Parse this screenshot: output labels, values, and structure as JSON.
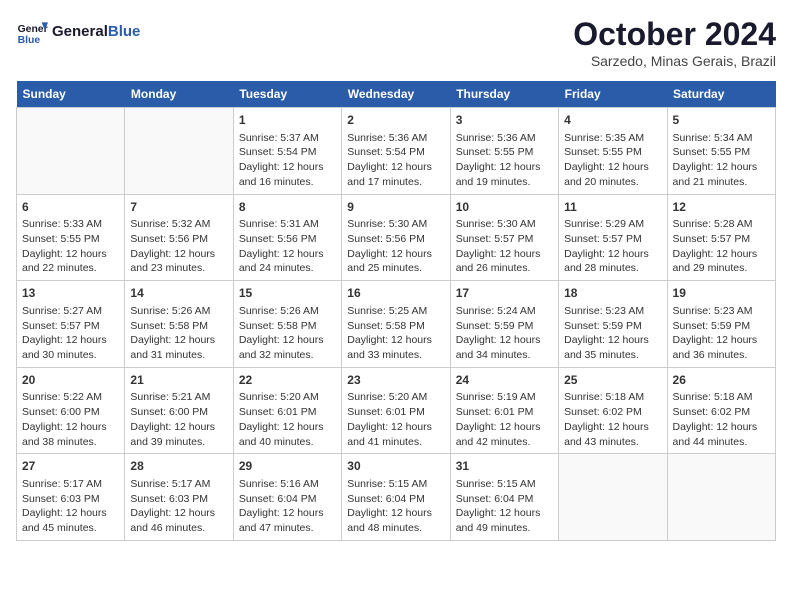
{
  "header": {
    "logo_line1": "General",
    "logo_line2": "Blue",
    "month_title": "October 2024",
    "subtitle": "Sarzedo, Minas Gerais, Brazil"
  },
  "days_of_week": [
    "Sunday",
    "Monday",
    "Tuesday",
    "Wednesday",
    "Thursday",
    "Friday",
    "Saturday"
  ],
  "weeks": [
    [
      {
        "day": "",
        "sunrise": "",
        "sunset": "",
        "daylight": ""
      },
      {
        "day": "",
        "sunrise": "",
        "sunset": "",
        "daylight": ""
      },
      {
        "day": "1",
        "sunrise": "Sunrise: 5:37 AM",
        "sunset": "Sunset: 5:54 PM",
        "daylight": "Daylight: 12 hours and 16 minutes."
      },
      {
        "day": "2",
        "sunrise": "Sunrise: 5:36 AM",
        "sunset": "Sunset: 5:54 PM",
        "daylight": "Daylight: 12 hours and 17 minutes."
      },
      {
        "day": "3",
        "sunrise": "Sunrise: 5:36 AM",
        "sunset": "Sunset: 5:55 PM",
        "daylight": "Daylight: 12 hours and 19 minutes."
      },
      {
        "day": "4",
        "sunrise": "Sunrise: 5:35 AM",
        "sunset": "Sunset: 5:55 PM",
        "daylight": "Daylight: 12 hours and 20 minutes."
      },
      {
        "day": "5",
        "sunrise": "Sunrise: 5:34 AM",
        "sunset": "Sunset: 5:55 PM",
        "daylight": "Daylight: 12 hours and 21 minutes."
      }
    ],
    [
      {
        "day": "6",
        "sunrise": "Sunrise: 5:33 AM",
        "sunset": "Sunset: 5:55 PM",
        "daylight": "Daylight: 12 hours and 22 minutes."
      },
      {
        "day": "7",
        "sunrise": "Sunrise: 5:32 AM",
        "sunset": "Sunset: 5:56 PM",
        "daylight": "Daylight: 12 hours and 23 minutes."
      },
      {
        "day": "8",
        "sunrise": "Sunrise: 5:31 AM",
        "sunset": "Sunset: 5:56 PM",
        "daylight": "Daylight: 12 hours and 24 minutes."
      },
      {
        "day": "9",
        "sunrise": "Sunrise: 5:30 AM",
        "sunset": "Sunset: 5:56 PM",
        "daylight": "Daylight: 12 hours and 25 minutes."
      },
      {
        "day": "10",
        "sunrise": "Sunrise: 5:30 AM",
        "sunset": "Sunset: 5:57 PM",
        "daylight": "Daylight: 12 hours and 26 minutes."
      },
      {
        "day": "11",
        "sunrise": "Sunrise: 5:29 AM",
        "sunset": "Sunset: 5:57 PM",
        "daylight": "Daylight: 12 hours and 28 minutes."
      },
      {
        "day": "12",
        "sunrise": "Sunrise: 5:28 AM",
        "sunset": "Sunset: 5:57 PM",
        "daylight": "Daylight: 12 hours and 29 minutes."
      }
    ],
    [
      {
        "day": "13",
        "sunrise": "Sunrise: 5:27 AM",
        "sunset": "Sunset: 5:57 PM",
        "daylight": "Daylight: 12 hours and 30 minutes."
      },
      {
        "day": "14",
        "sunrise": "Sunrise: 5:26 AM",
        "sunset": "Sunset: 5:58 PM",
        "daylight": "Daylight: 12 hours and 31 minutes."
      },
      {
        "day": "15",
        "sunrise": "Sunrise: 5:26 AM",
        "sunset": "Sunset: 5:58 PM",
        "daylight": "Daylight: 12 hours and 32 minutes."
      },
      {
        "day": "16",
        "sunrise": "Sunrise: 5:25 AM",
        "sunset": "Sunset: 5:58 PM",
        "daylight": "Daylight: 12 hours and 33 minutes."
      },
      {
        "day": "17",
        "sunrise": "Sunrise: 5:24 AM",
        "sunset": "Sunset: 5:59 PM",
        "daylight": "Daylight: 12 hours and 34 minutes."
      },
      {
        "day": "18",
        "sunrise": "Sunrise: 5:23 AM",
        "sunset": "Sunset: 5:59 PM",
        "daylight": "Daylight: 12 hours and 35 minutes."
      },
      {
        "day": "19",
        "sunrise": "Sunrise: 5:23 AM",
        "sunset": "Sunset: 5:59 PM",
        "daylight": "Daylight: 12 hours and 36 minutes."
      }
    ],
    [
      {
        "day": "20",
        "sunrise": "Sunrise: 5:22 AM",
        "sunset": "Sunset: 6:00 PM",
        "daylight": "Daylight: 12 hours and 38 minutes."
      },
      {
        "day": "21",
        "sunrise": "Sunrise: 5:21 AM",
        "sunset": "Sunset: 6:00 PM",
        "daylight": "Daylight: 12 hours and 39 minutes."
      },
      {
        "day": "22",
        "sunrise": "Sunrise: 5:20 AM",
        "sunset": "Sunset: 6:01 PM",
        "daylight": "Daylight: 12 hours and 40 minutes."
      },
      {
        "day": "23",
        "sunrise": "Sunrise: 5:20 AM",
        "sunset": "Sunset: 6:01 PM",
        "daylight": "Daylight: 12 hours and 41 minutes."
      },
      {
        "day": "24",
        "sunrise": "Sunrise: 5:19 AM",
        "sunset": "Sunset: 6:01 PM",
        "daylight": "Daylight: 12 hours and 42 minutes."
      },
      {
        "day": "25",
        "sunrise": "Sunrise: 5:18 AM",
        "sunset": "Sunset: 6:02 PM",
        "daylight": "Daylight: 12 hours and 43 minutes."
      },
      {
        "day": "26",
        "sunrise": "Sunrise: 5:18 AM",
        "sunset": "Sunset: 6:02 PM",
        "daylight": "Daylight: 12 hours and 44 minutes."
      }
    ],
    [
      {
        "day": "27",
        "sunrise": "Sunrise: 5:17 AM",
        "sunset": "Sunset: 6:03 PM",
        "daylight": "Daylight: 12 hours and 45 minutes."
      },
      {
        "day": "28",
        "sunrise": "Sunrise: 5:17 AM",
        "sunset": "Sunset: 6:03 PM",
        "daylight": "Daylight: 12 hours and 46 minutes."
      },
      {
        "day": "29",
        "sunrise": "Sunrise: 5:16 AM",
        "sunset": "Sunset: 6:04 PM",
        "daylight": "Daylight: 12 hours and 47 minutes."
      },
      {
        "day": "30",
        "sunrise": "Sunrise: 5:15 AM",
        "sunset": "Sunset: 6:04 PM",
        "daylight": "Daylight: 12 hours and 48 minutes."
      },
      {
        "day": "31",
        "sunrise": "Sunrise: 5:15 AM",
        "sunset": "Sunset: 6:04 PM",
        "daylight": "Daylight: 12 hours and 49 minutes."
      },
      {
        "day": "",
        "sunrise": "",
        "sunset": "",
        "daylight": ""
      },
      {
        "day": "",
        "sunrise": "",
        "sunset": "",
        "daylight": ""
      }
    ]
  ]
}
